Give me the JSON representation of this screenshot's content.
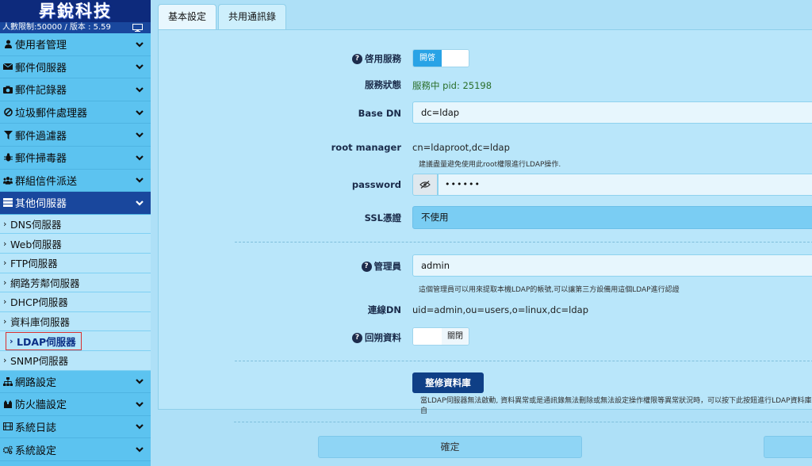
{
  "sidebar": {
    "logo": "昇銳科技",
    "limit": "人數限制:50000 / 版本 : 5.59",
    "menus": [
      {
        "label": "使用者管理",
        "icon": "user-icon"
      },
      {
        "label": "郵件伺服器",
        "icon": "envelope-icon"
      },
      {
        "label": "郵件記錄器",
        "icon": "camera-icon"
      },
      {
        "label": "垃圾郵件處理器",
        "icon": "ban-icon"
      },
      {
        "label": "郵件過濾器",
        "icon": "filter-icon"
      },
      {
        "label": "郵件掃毒器",
        "icon": "bug-icon"
      },
      {
        "label": "群組信件派送",
        "icon": "users-icon"
      },
      {
        "label": "其他伺服器",
        "icon": "server-icon"
      },
      {
        "label": "網路設定",
        "icon": "network-icon"
      },
      {
        "label": "防火牆設定",
        "icon": "firewall-icon"
      },
      {
        "label": "系統日誌",
        "icon": "film-icon"
      },
      {
        "label": "系統設定",
        "icon": "cogs-icon"
      }
    ],
    "submenu": [
      "DNS伺服器",
      "Web伺服器",
      "FTP伺服器",
      "網路芳鄰伺服器",
      "DHCP伺服器",
      "資料庫伺服器",
      "LDAP伺服器",
      "SNMP伺服器"
    ]
  },
  "tabs": [
    "基本設定",
    "共用通訊錄"
  ],
  "form": {
    "enable_label": "啓用服務",
    "enable_on": "開啓",
    "status_label": "服務狀態",
    "status_value": "服務中 pid: 25198",
    "basedn_label": "Base DN",
    "basedn_value": "dc=ldap",
    "root_label": "root manager",
    "root_value": "cn=ldaproot,dc=ldap",
    "root_hint": "建議盡量避免使用此root權限進行LDAP操作.",
    "password_label": "password",
    "password_value": "••••••",
    "ssl_label": "SSL憑證",
    "ssl_value": "不使用",
    "admin_label": "管理員",
    "admin_value": "admin",
    "admin_hint": "這個管理員可以用來提取本機LDAP的帳號,可以讓第三方設備用這個LDAP進行認證",
    "conn_label": "連線DN",
    "conn_value": "uid=admin,ou=users,o=linux,dc=ldap",
    "backtrack_label": "回朔資料",
    "backtrack_off": "關閉",
    "repair_button": "整修資料庫",
    "repair_hint": "當LDAP伺服器無法啟動, 資料異常或是通訊錄無法刪除或無法設定操作權限等異常狀況時，可以按下此按鈕進行LDAP資料庫自",
    "ok_button": "確定"
  }
}
